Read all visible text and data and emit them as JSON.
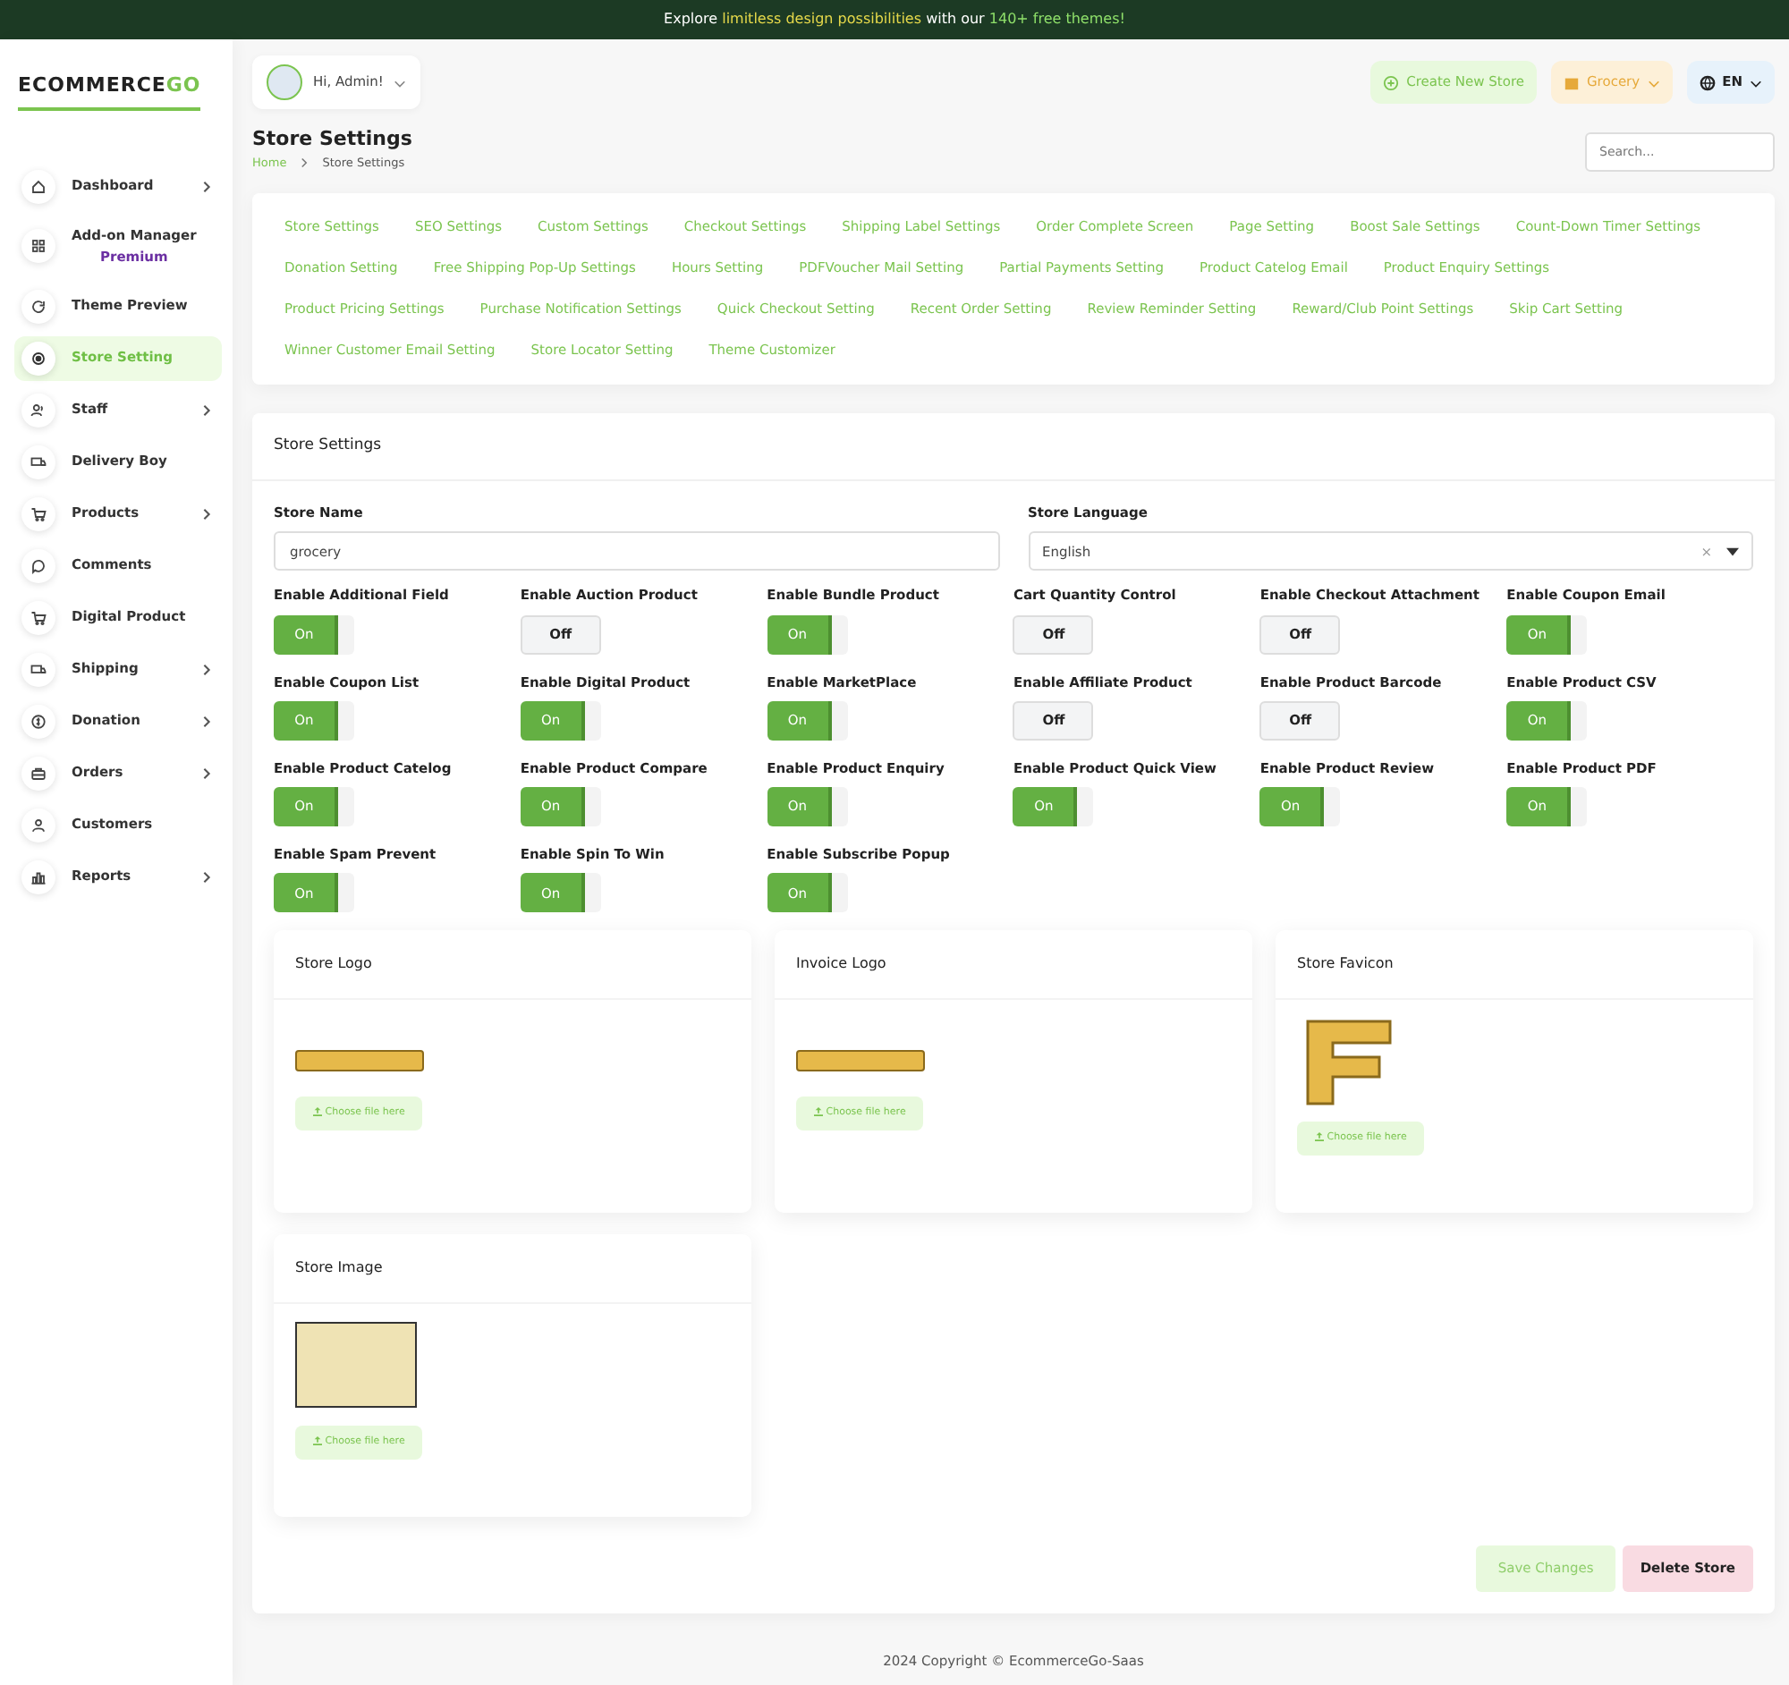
{
  "banner": [
    {
      "text": "Explore ",
      "color": "#ffffff"
    },
    {
      "text": "limitless design possibilities",
      "color": "#e5d84a"
    },
    {
      "text": " with our ",
      "color": "#ffffff"
    },
    {
      "text": "140+ free themes!",
      "color": "#8fe06a"
    }
  ],
  "brand": {
    "logo": "ECOMMERCEGO"
  },
  "user_menu": {
    "greeting": "Hi, Admin!"
  },
  "header_actions": {
    "create_store": "Create New Store",
    "store_switcher": "Grocery",
    "language": "EN"
  },
  "sidebar": {
    "items": [
      {
        "label": "Dashboard",
        "has_submenu": true,
        "selected": false
      },
      {
        "label": "Add-on Manager",
        "badge": "Premium",
        "has_submenu": false,
        "selected": false
      },
      {
        "label": "Theme Preview",
        "has_submenu": false,
        "selected": false
      },
      {
        "label": "Store Setting",
        "has_submenu": false,
        "selected": true
      },
      {
        "label": "Staff",
        "has_submenu": true,
        "selected": false
      },
      {
        "label": "Delivery Boy",
        "has_submenu": false,
        "selected": false
      },
      {
        "label": "Products",
        "has_submenu": true,
        "selected": false
      },
      {
        "label": "Comments",
        "has_submenu": false,
        "selected": false
      },
      {
        "label": "Digital Product",
        "has_submenu": false,
        "selected": false
      },
      {
        "label": "Shipping",
        "has_submenu": true,
        "selected": false
      },
      {
        "label": "Donation",
        "has_submenu": true,
        "selected": false
      },
      {
        "label": "Orders",
        "has_submenu": true,
        "selected": false
      },
      {
        "label": "Customers",
        "has_submenu": false,
        "selected": false
      },
      {
        "label": "Reports",
        "has_submenu": true,
        "selected": false
      }
    ]
  },
  "page": {
    "title": "Store Settings",
    "breadcrumb": [
      "Home",
      "Store Settings"
    ],
    "search": {
      "placeholder": "Search..."
    }
  },
  "settings_tabs": [
    "Store Settings",
    "SEO Settings",
    "Custom Settings",
    "Checkout Settings",
    "Shipping Label Settings",
    "Order Complete Screen",
    "Page Setting",
    "Boost Sale Settings",
    "Count-Down Timer Settings",
    "Donation Setting",
    "Free Shipping Pop-Up Settings",
    "Hours Setting",
    "PDFVoucher Mail Setting",
    "Partial Payments Setting",
    "Product Catelog Email",
    "Product Enquiry Settings",
    "Product Pricing Settings",
    "Purchase Notification Settings",
    "Quick Checkout Setting",
    "Recent Order Setting",
    "Review Reminder Setting",
    "Reward/Club Point Settings",
    "Skip Cart Setting",
    "Winner Customer Email Setting",
    "Store Locator Setting",
    "Theme Customizer"
  ],
  "store_settings": {
    "title": "Store Settings",
    "store_name": {
      "label": "Store Name",
      "value": "grocery"
    },
    "store_language": {
      "label": "Store Language",
      "value": "English",
      "clear": "×"
    },
    "toggles": [
      {
        "label": "Enable Additional Field",
        "on": true,
        "text": "On"
      },
      {
        "label": "Enable Auction Product",
        "on": false,
        "text": "Off"
      },
      {
        "label": "Enable Bundle Product",
        "on": true,
        "text": "On"
      },
      {
        "label": "Cart Quantity Control",
        "on": false,
        "text": "Off"
      },
      {
        "label": "Enable Checkout Attachment",
        "on": false,
        "text": "Off"
      },
      {
        "label": "Enable Coupon Email",
        "on": true,
        "text": "On"
      },
      {
        "label": "Enable Coupon List",
        "on": true,
        "text": "On"
      },
      {
        "label": "Enable Digital Product",
        "on": true,
        "text": "On"
      },
      {
        "label": "Enable MarketPlace",
        "on": true,
        "text": "On"
      },
      {
        "label": "Enable Affiliate Product",
        "on": false,
        "text": "Off"
      },
      {
        "label": "Enable Product Barcode",
        "on": false,
        "text": "Off"
      },
      {
        "label": "Enable Product CSV",
        "on": true,
        "text": "On"
      },
      {
        "label": "Enable Product Catelog",
        "on": true,
        "text": "On"
      },
      {
        "label": "Enable Product Compare",
        "on": true,
        "text": "On"
      },
      {
        "label": "Enable Product Enquiry",
        "on": true,
        "text": "On"
      },
      {
        "label": "Enable Product Quick View",
        "on": true,
        "text": "On"
      },
      {
        "label": "Enable Product Review",
        "on": true,
        "text": "On"
      },
      {
        "label": "Enable Product PDF",
        "on": true,
        "text": "On"
      },
      {
        "label": "Enable Spam Prevent",
        "on": true,
        "text": "On"
      },
      {
        "label": "Enable Spin To Win",
        "on": true,
        "text": "On"
      },
      {
        "label": "Enable Subscribe Popup",
        "on": true,
        "text": "On"
      }
    ],
    "uploads": [
      {
        "title": "Store Logo",
        "kind": "wordmark",
        "button": "Choose file here"
      },
      {
        "title": "Invoice Logo",
        "kind": "wordmark",
        "button": "Choose file here"
      },
      {
        "title": "Store Favicon",
        "kind": "favicon",
        "button": "Choose file here"
      },
      {
        "title": "Store Image",
        "kind": "screenshot",
        "button": "Choose file here"
      }
    ],
    "save_button": "Save Changes",
    "delete_button": "Delete Store"
  },
  "footer": "2024 Copyright © EcommerceGo-Saas"
}
